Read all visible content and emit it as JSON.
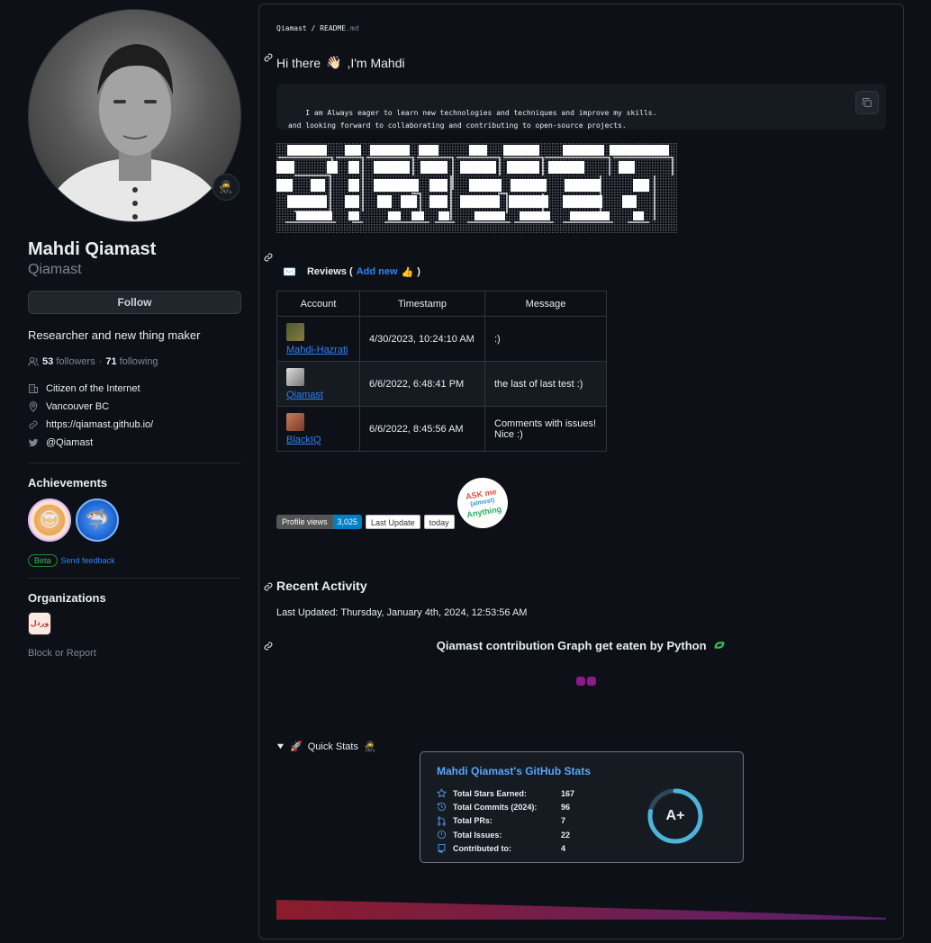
{
  "profile": {
    "fullname": "Mahdi Qiamast",
    "login": "Qiamast",
    "follow_label": "Follow",
    "bio": "Researcher and new thing maker",
    "followers_count": "53",
    "followers_label": "followers",
    "separator": "·",
    "following_count": "71",
    "following_label": "following",
    "company": "Citizen of the Internet",
    "location": "Vancouver BC",
    "website": "https://qiamast.github.io/",
    "twitter": "@Qiamast",
    "status_emoji": "🥷"
  },
  "achievements": {
    "heading": "Achievements",
    "items": [
      "😎",
      "🦈"
    ],
    "beta_label": "Beta",
    "feedback_label": "Send feedback"
  },
  "organizations": {
    "heading": "Organizations",
    "logo_text": "وردل",
    "block_label": "Block or Report"
  },
  "readme": {
    "crumb_owner": "Qiamast",
    "crumb_sep": "/",
    "crumb_file": "README",
    "crumb_ext": ".md",
    "heading_pre": "Hi there",
    "heading_emoji": "👋🏻",
    "heading_post": ",I'm Mahdi",
    "code_text": "I am Always eager to learn new technologies and techniques and improve my skills.\nand looking forward to collaborating and contributing to open-source projects.",
    "reviews": {
      "icon": "✉️",
      "label": "Reviews (",
      "add_new": "Add new",
      "add_emoji": "👍",
      "close": ")",
      "columns": [
        "Account",
        "Timestamp",
        "Message"
      ],
      "rows": [
        {
          "account": "Mahdi-Hazrati",
          "timestamp": "4/30/2023, 10:24:10 AM",
          "message": ":)"
        },
        {
          "account": "Qiamast",
          "timestamp": "6/6/2022, 6:48:41 PM",
          "message": "the last of last test :)"
        },
        {
          "account": "BlackIQ",
          "timestamp": "6/6/2022, 8:45:56 AM",
          "message": "Comments with issues! Nice :)"
        }
      ]
    },
    "badges": {
      "views_label": "Profile views",
      "views_value": "3,025",
      "last_update_label": "Last Update",
      "last_update_value": "today",
      "ama_line1": "ASK me",
      "ama_line2": "(almost)",
      "ama_line3": "Anything"
    },
    "recent_activity": "Recent Activity",
    "last_updated": "Last Updated: Thursday, January 4th, 2024, 12:53:56 AM",
    "graph_title": "Qiamast contribution Graph get eaten by Python",
    "quick_stats": {
      "summary_emoji": "🚀",
      "summary_label": "Quick Stats",
      "summary_end_emoji": "🥷"
    },
    "stats_card": {
      "title": "Mahdi Qiamast's GitHub Stats",
      "rank": "A+",
      "rank_progress": 0.78,
      "items": [
        {
          "icon": "star-icon",
          "label": "Total Stars Earned:",
          "value": "167"
        },
        {
          "icon": "history-icon",
          "label": "Total Commits (2024):",
          "value": "96"
        },
        {
          "icon": "pull-request-icon",
          "label": "Total PRs:",
          "value": "7"
        },
        {
          "icon": "issue-icon",
          "label": "Total Issues:",
          "value": "22"
        },
        {
          "icon": "repo-icon",
          "label": "Contributed to:",
          "value": "4"
        }
      ]
    }
  },
  "colors": {
    "accent": "#2f81f7",
    "stats_title": "#58a6ff",
    "rank_ring": "#4fb3d9",
    "snake": "#8b1a8b"
  }
}
